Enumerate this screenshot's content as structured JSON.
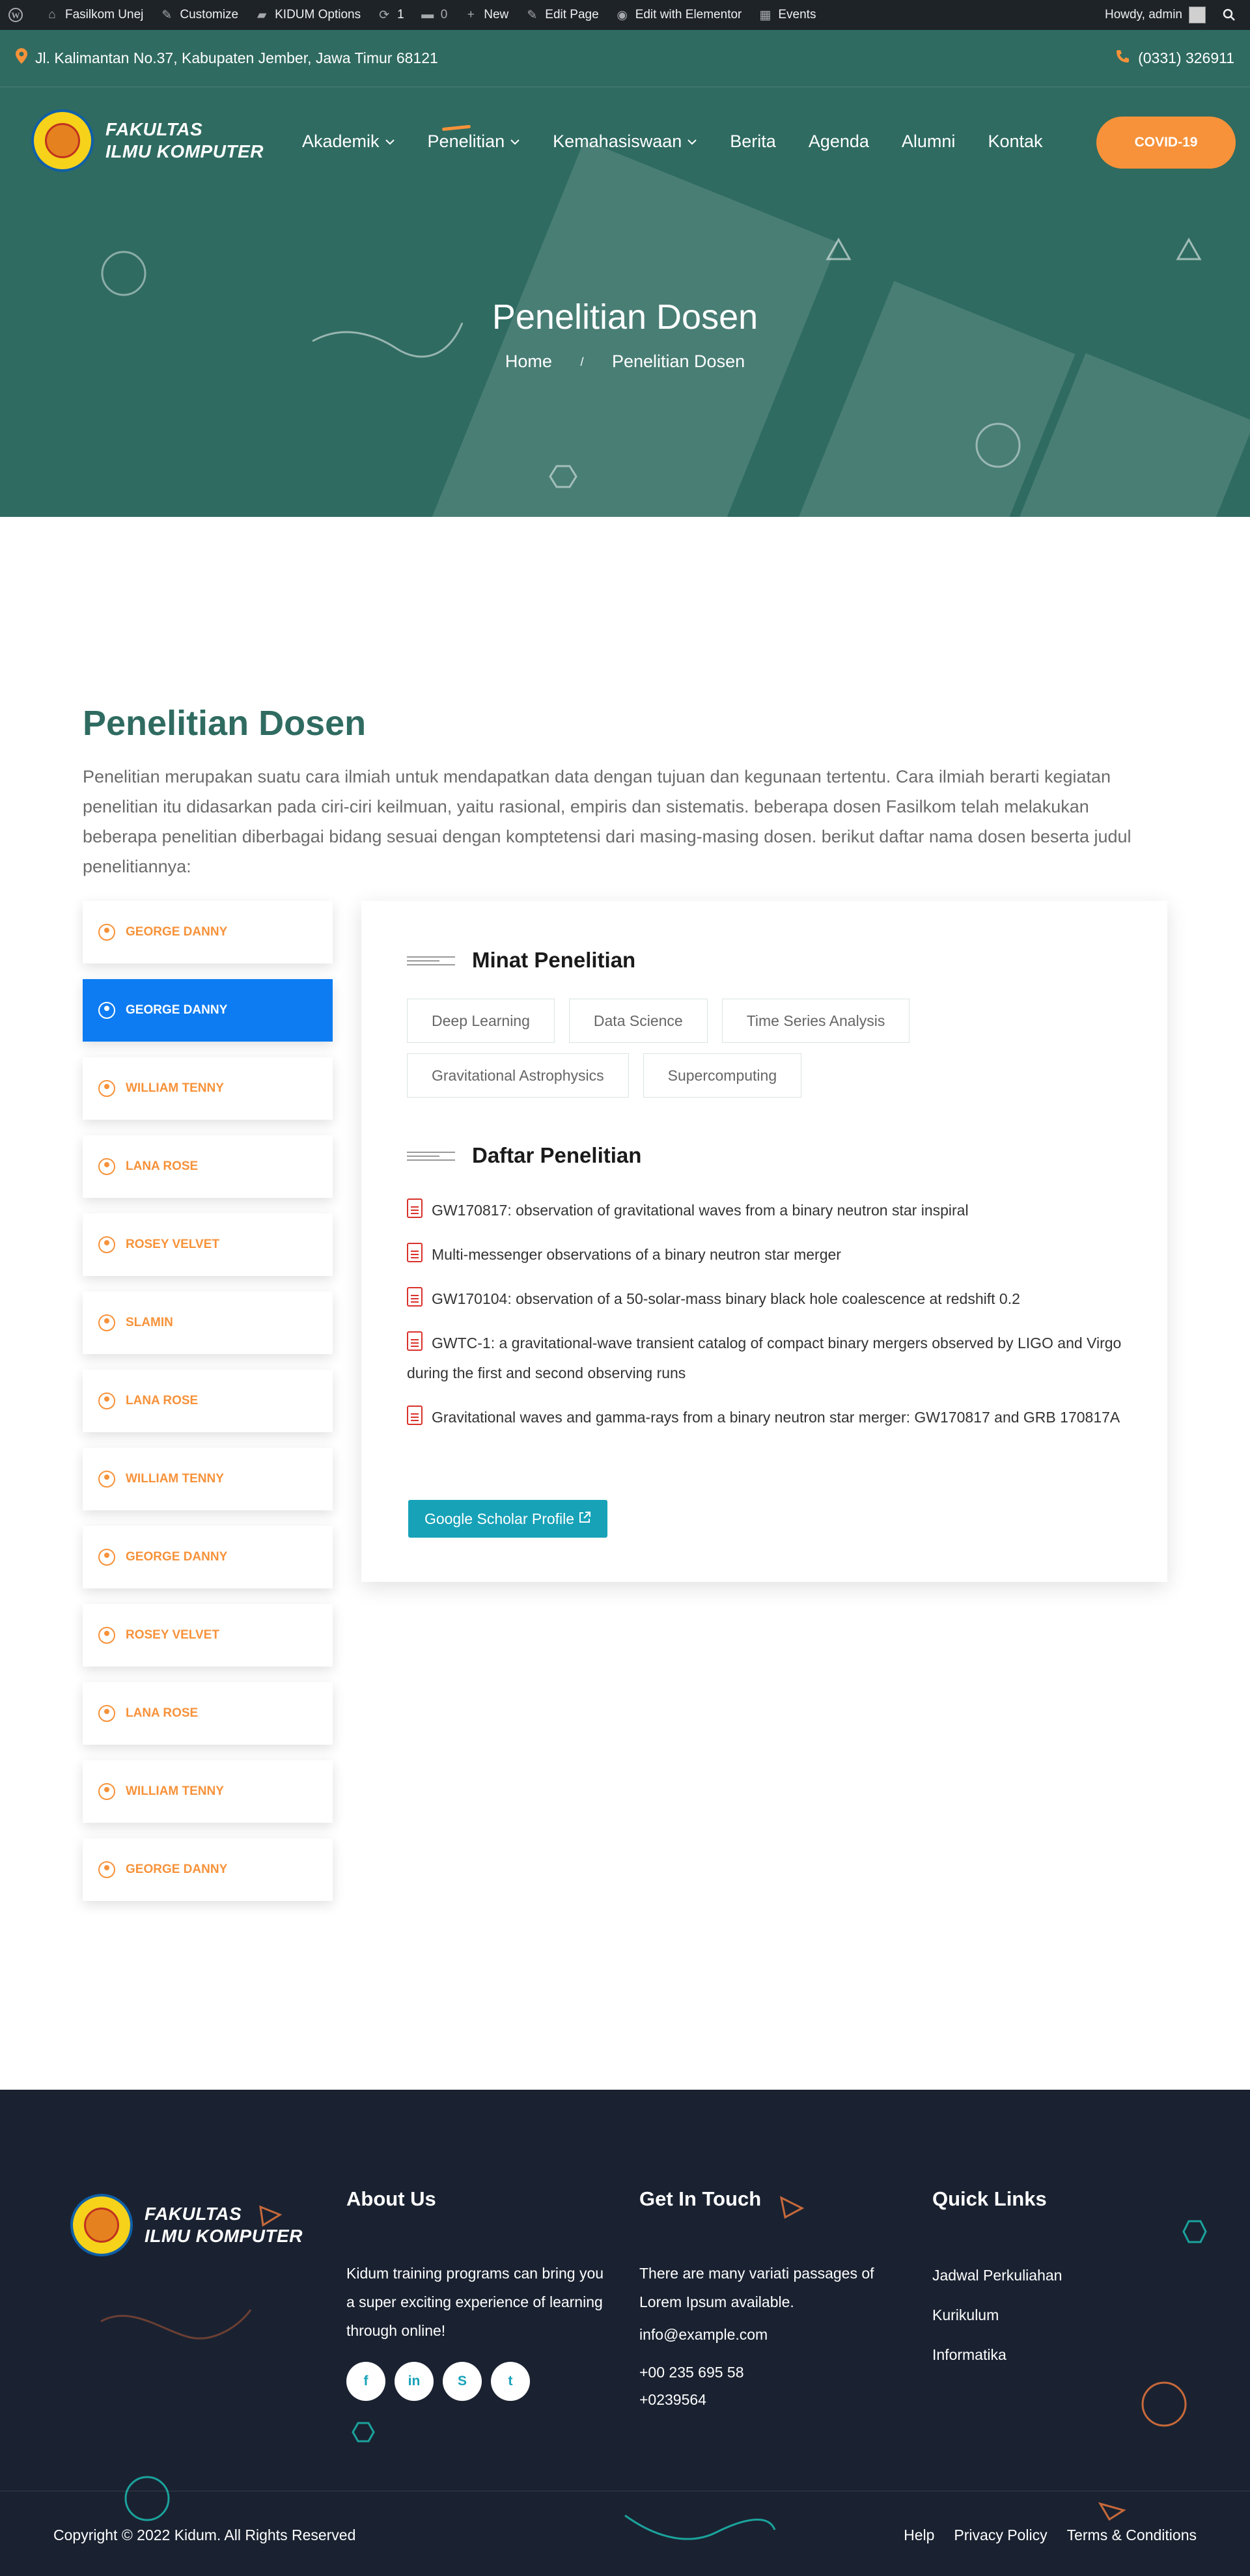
{
  "adminbar": {
    "site": "Fasilkom Unej",
    "customize": "Customize",
    "options": "KIDUM Options",
    "updates": "1",
    "comments": "0",
    "new": "New",
    "edit_page": "Edit Page",
    "elementor": "Edit with Elementor",
    "events": "Events",
    "howdy": "Howdy, admin"
  },
  "topbar": {
    "address": "Jl. Kalimantan No.37, Kabupaten Jember, Jawa Timur 68121",
    "phone": "(0331) 326911"
  },
  "logo": {
    "line1": "FAKULTAS",
    "line2": "ILMU KOMPUTER"
  },
  "nav": {
    "items": [
      {
        "label": "Akademik",
        "chevron": "⌵"
      },
      {
        "label": "Penelitian",
        "chevron": "⌵"
      },
      {
        "label": "Kemahasiswaan",
        "chevron": "⌵"
      },
      {
        "label": "Berita"
      },
      {
        "label": "Agenda"
      },
      {
        "label": "Alumni"
      },
      {
        "label": "Kontak"
      }
    ],
    "cta": "COVID-19"
  },
  "hero": {
    "title": "Penelitian Dosen",
    "breadcrumb": {
      "home": "Home",
      "separator": "/",
      "current": "Penelitian Dosen"
    }
  },
  "main": {
    "title": "Penelitian Dosen",
    "intro": "Penelitian merupakan suatu cara ilmiah untuk mendapatkan data dengan tujuan dan kegunaan tertentu. Cara ilmiah berarti kegiatan penelitian itu didasarkan pada ciri-ciri keilmuan, yaitu rasional, empiris dan sistematis. beberapa dosen Fasilkom telah melakukan beberapa penelitian diberbagai bidang sesuai dengan komptetensi dari masing-masing dosen. berikut daftar nama dosen beserta judul penelitiannya:"
  },
  "lecturers": [
    "GEORGE DANNY",
    "GEORGE DANNY",
    "WILLIAM TENNY",
    "LANA ROSE",
    "ROSEY VELVET",
    "SLAMIN",
    "LANA ROSE",
    "WILLIAM TENNY",
    "GEORGE DANNY",
    "ROSEY VELVET",
    "LANA ROSE",
    "WILLIAM TENNY",
    "GEORGE DANNY"
  ],
  "card": {
    "interests_title": "Minat Penelitian",
    "interests": [
      "Deep Learning",
      "Data Science",
      "Time Series Analysis",
      "Gravitational Astrophysics",
      "Supercomputing"
    ],
    "research_title": "Daftar Penelitian",
    "research": [
      "GW170817: observation of gravitational waves from a binary neutron star inspiral",
      "Multi-messenger observations of a binary neutron star merger",
      "GW170104: observation of a 50-solar-mass binary black hole coalescence at redshift 0.2",
      "GWTC-1: a gravitational-wave transient catalog of compact binary mergers observed by LIGO and Virgo during the first and second observing runs",
      "Gravitational waves and gamma-rays from a binary neutron star merger: GW170817 and GRB 170817A"
    ],
    "scholar_button": "Google Scholar Profile"
  },
  "footer": {
    "about_title": "About Us",
    "about_text": "Kidum training programs can bring you a super exciting experience of learning through online!",
    "contact_title": "Get In Touch",
    "contact_text": "There are many variati passages of Lorem Ipsum available.",
    "email": "info@example.com",
    "phone1": "+00 235 695 58",
    "phone2": "+0239564",
    "links_title": "Quick Links",
    "links": [
      "Jadwal Perkuliahan",
      "Kurikulum",
      "Informatika"
    ],
    "social": [
      "f",
      "in",
      "S",
      "t"
    ],
    "copyright": "Copyright © 2022 Kidum. All Rights Reserved",
    "bottom_links": [
      "Help",
      "Privacy Policy",
      "Terms & Conditions"
    ]
  },
  "colors": {
    "hero_bg": "#2f6b61",
    "accent_orange": "#f7923a",
    "active_tab": "#0d7cf2",
    "scholar_button": "#17a2b8",
    "footer_bg": "#1a2231"
  }
}
